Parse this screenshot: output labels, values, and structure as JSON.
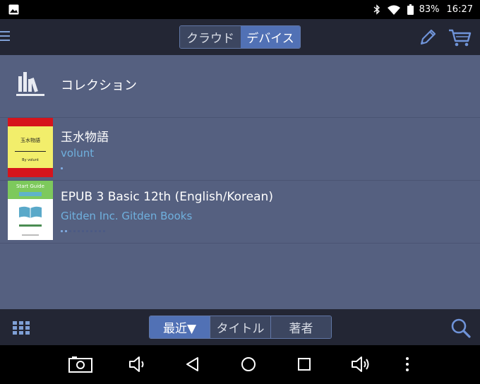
{
  "status_bar": {
    "battery_pct": "83%",
    "time": "16:27"
  },
  "top_bar": {
    "segment": [
      "クラウド",
      "デバイス"
    ],
    "selected": "デバイス"
  },
  "collection": {
    "label": "コレクション"
  },
  "books": [
    {
      "title": "玉水物語",
      "author": "volunt",
      "cover_title": "玉水物語",
      "cover_author": "By volunt",
      "progress_dots": 1,
      "progress_read": 1
    },
    {
      "title": "EPUB 3 Basic 12th (English/Korean)",
      "author": "Gitden Inc.  Gitden Books",
      "cover_title": "Start Guide",
      "progress_dots": 11,
      "progress_read": 2
    }
  ],
  "bottom_bar": {
    "sort_options": [
      "最近▼",
      "タイトル",
      "著者"
    ],
    "selected": "最近▼"
  },
  "icons": {
    "menu": "menu-icon",
    "edit": "pencil-icon",
    "store": "cart-icon",
    "view": "grid-icon",
    "search": "search-icon"
  },
  "colors": {
    "accent": "#5171b5",
    "content_bg": "#556080",
    "bar_bg": "#232634",
    "author_text": "#6fb0de"
  }
}
